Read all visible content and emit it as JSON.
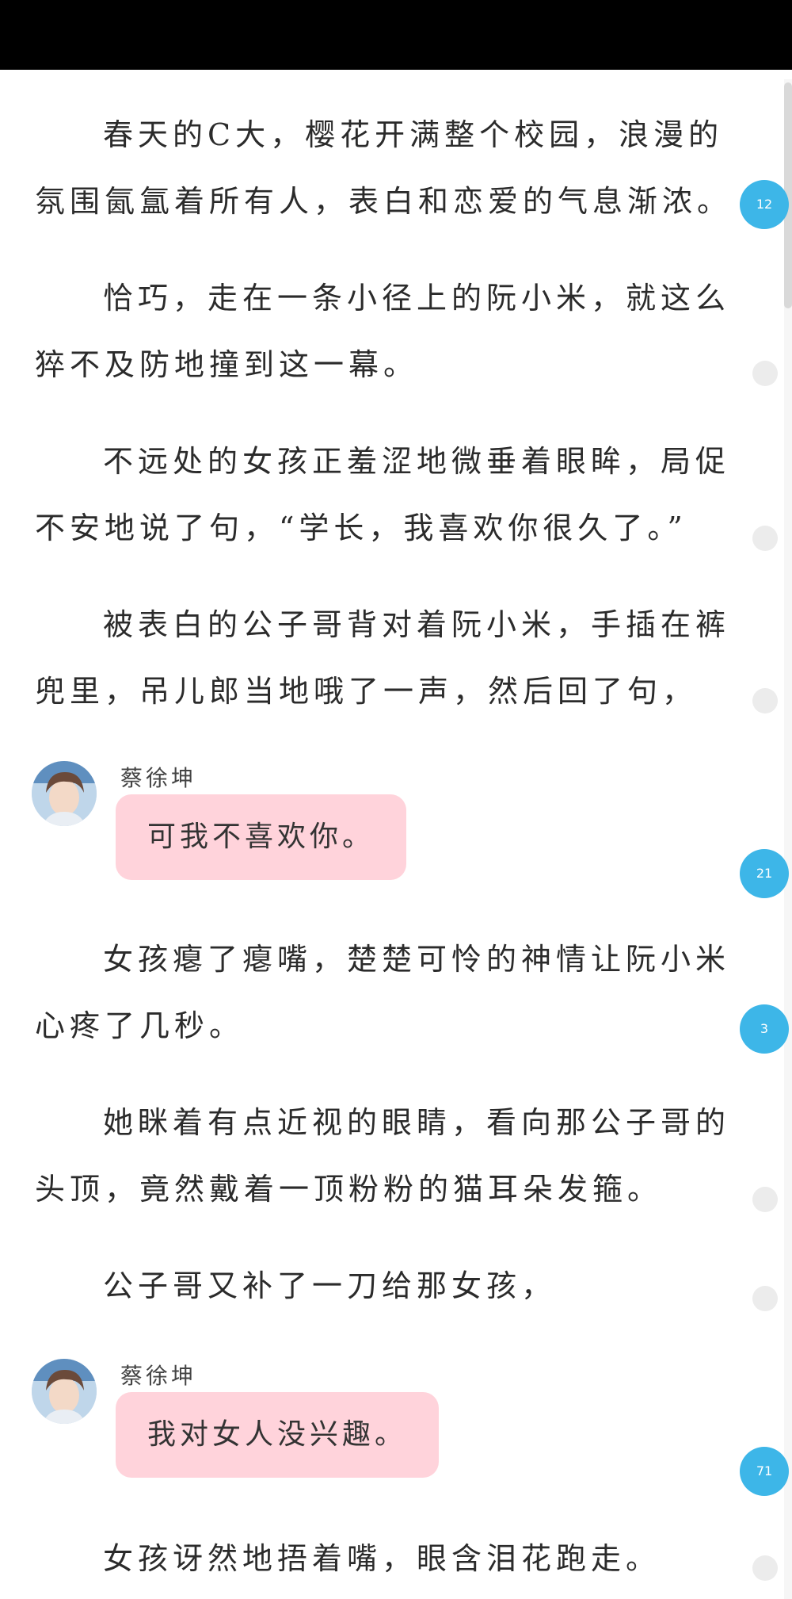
{
  "paragraphs": [
    "春天的C大，樱花开满整个校园，浪漫的氛围氤氲着所有人，表白和恋爱的气息渐浓。",
    "恰巧，走在一条小径上的阮小米，就这么猝不及防地撞到这一幕。",
    "不远处的女孩正羞涩地微垂着眼眸，局促不安地说了句，“学长，我喜欢你很久了。”",
    "被表白的公子哥背对着阮小米，手插在裤兜里，吊儿郎当地哦了一声，然后回了句，",
    "女孩瘪了瘪嘴，楚楚可怜的神情让阮小米心疼了几秒。",
    "她眯着有点近视的眼睛，看向那公子哥的头顶，竟然戴着一顶粉粉的猫耳朵发箍。",
    "公子哥又补了一刀给那女孩，",
    "女孩讶然地捂着嘴，眼含泪花跑走。"
  ],
  "messages": [
    {
      "sender": "蔡徐坤",
      "text": "可我不喜欢你。"
    },
    {
      "sender": "蔡徐坤",
      "text": "我对女人没兴趣。"
    }
  ],
  "comment_badges": [
    "12",
    "21",
    "3",
    "71"
  ],
  "colors": {
    "badge": "#3db6e8",
    "bubble": "#ffd3db",
    "status_bar": "#000000"
  }
}
